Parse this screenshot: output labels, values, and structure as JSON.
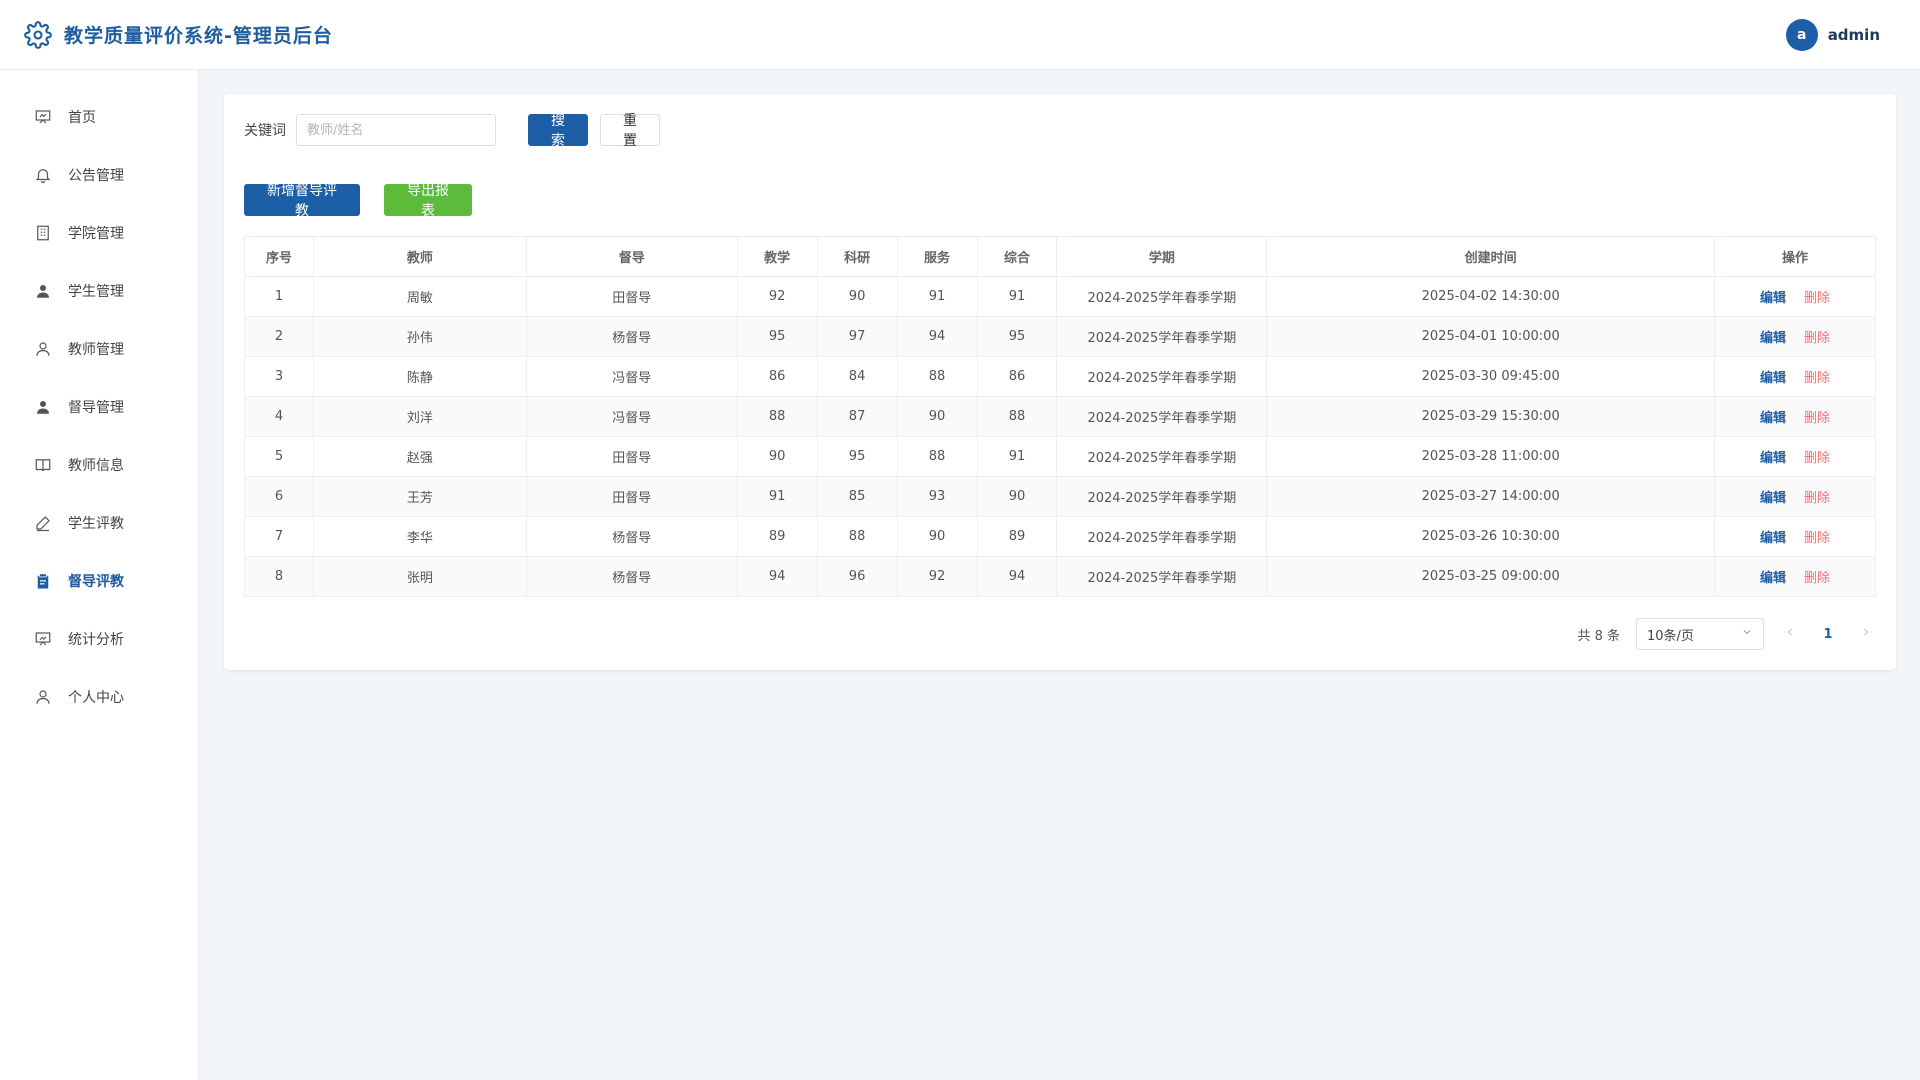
{
  "app": {
    "title": "教学质量评价系统-管理员后台"
  },
  "user": {
    "avatar_letter": "a",
    "name": "admin"
  },
  "sidebar": {
    "items": [
      {
        "label": "首页",
        "icon": "presentation-icon"
      },
      {
        "label": "公告管理",
        "icon": "bell-icon"
      },
      {
        "label": "学院管理",
        "icon": "building-icon"
      },
      {
        "label": "学生管理",
        "icon": "user-filled-icon"
      },
      {
        "label": "教师管理",
        "icon": "user-icon"
      },
      {
        "label": "督导管理",
        "icon": "user-filled-icon"
      },
      {
        "label": "教师信息",
        "icon": "book-icon"
      },
      {
        "label": "学生评教",
        "icon": "pen-icon"
      },
      {
        "label": "督导评教",
        "icon": "clipboard-icon",
        "active": true
      },
      {
        "label": "统计分析",
        "icon": "chart-board-icon"
      },
      {
        "label": "个人中心",
        "icon": "user-icon"
      }
    ]
  },
  "search": {
    "label": "关键词",
    "placeholder": "教师/姓名",
    "search_label": "搜索",
    "reset_label": "重置"
  },
  "actions": {
    "add_label": "新增督导评教",
    "export_label": "导出报表"
  },
  "table": {
    "columns": [
      "序号",
      "教师",
      "督导",
      "教学",
      "科研",
      "服务",
      "综合",
      "学期",
      "创建时间",
      "操作"
    ],
    "edit_label": "编辑",
    "delete_label": "删除",
    "rows": [
      [
        "1",
        "周敏",
        "田督导",
        "92",
        "90",
        "91",
        "91",
        "2024-2025学年春季学期",
        "2025-04-02 14:30:00"
      ],
      [
        "2",
        "孙伟",
        "杨督导",
        "95",
        "97",
        "94",
        "95",
        "2024-2025学年春季学期",
        "2025-04-01 10:00:00"
      ],
      [
        "3",
        "陈静",
        "冯督导",
        "86",
        "84",
        "88",
        "86",
        "2024-2025学年春季学期",
        "2025-03-30 09:45:00"
      ],
      [
        "4",
        "刘洋",
        "冯督导",
        "88",
        "87",
        "90",
        "88",
        "2024-2025学年春季学期",
        "2025-03-29 15:30:00"
      ],
      [
        "5",
        "赵强",
        "田督导",
        "90",
        "95",
        "88",
        "91",
        "2024-2025学年春季学期",
        "2025-03-28 11:00:00"
      ],
      [
        "6",
        "王芳",
        "田督导",
        "91",
        "85",
        "93",
        "90",
        "2024-2025学年春季学期",
        "2025-03-27 14:00:00"
      ],
      [
        "7",
        "李华",
        "杨督导",
        "89",
        "88",
        "90",
        "89",
        "2024-2025学年春季学期",
        "2025-03-26 10:30:00"
      ],
      [
        "8",
        "张明",
        "杨督导",
        "94",
        "96",
        "92",
        "94",
        "2024-2025学年春季学期",
        "2025-03-25 09:00:00"
      ]
    ]
  },
  "pager": {
    "total_text": "共 8 条",
    "page_size": "10条/页",
    "current_page": "1"
  },
  "colors": {
    "brand": "#1f5d9e",
    "primary": "#1d5fa6",
    "export": "#5cbb3a",
    "danger": "#f56c6c"
  }
}
